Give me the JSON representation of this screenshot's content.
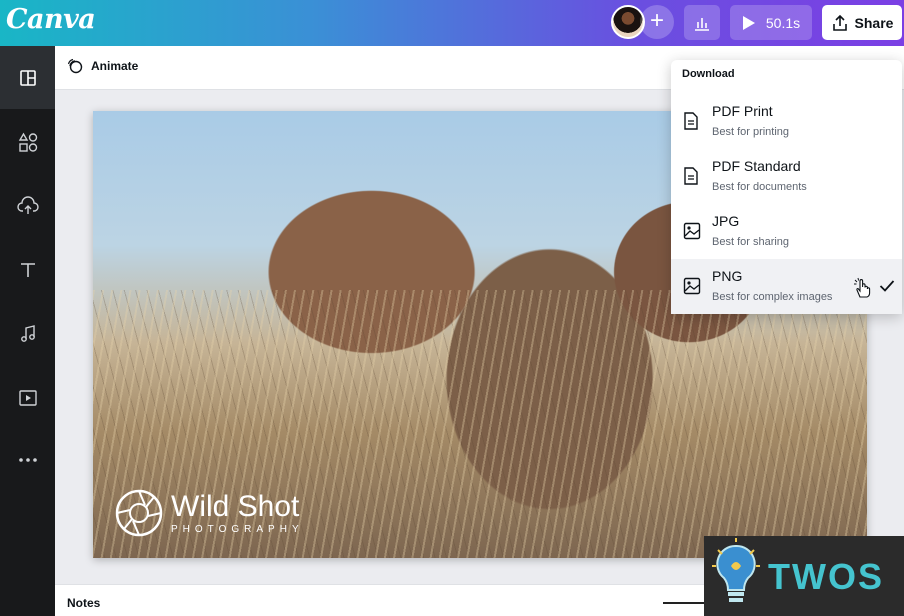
{
  "app": {
    "logo": "Canva"
  },
  "topbar": {
    "add_label": "+",
    "present_label": "50.1s",
    "share_label": "Share"
  },
  "rail": {
    "items": [
      {
        "icon": "layout-icon",
        "active": true
      },
      {
        "icon": "elements-icon"
      },
      {
        "icon": "upload-cloud-icon"
      },
      {
        "icon": "text-icon"
      },
      {
        "icon": "music-icon"
      },
      {
        "icon": "video-icon"
      },
      {
        "icon": "more-icon"
      }
    ]
  },
  "context_bar": {
    "animate_label": "Animate"
  },
  "canvas": {
    "watermark_title": "Wild Shot",
    "watermark_subtitle": "PHOTOGRAPHY"
  },
  "notes": {
    "label": "Notes"
  },
  "download": {
    "header": "Download",
    "items": [
      {
        "title": "PDF Print",
        "desc": "Best for printing",
        "icon": "document-icon"
      },
      {
        "title": "PDF Standard",
        "desc": "Best for documents",
        "icon": "document-icon"
      },
      {
        "title": "JPG",
        "desc": "Best for sharing",
        "icon": "image-icon"
      },
      {
        "title": "PNG",
        "desc": "Best for complex images",
        "icon": "image-icon",
        "selected": true
      }
    ]
  },
  "badge": {
    "text": "TWOS"
  },
  "colors": {
    "accent": "#7b3fe4",
    "teal": "#19b6c6",
    "badge_text": "#45c4cf"
  }
}
